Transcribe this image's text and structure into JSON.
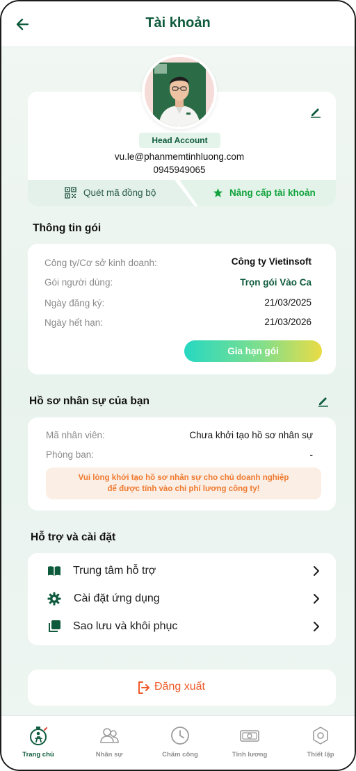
{
  "header": {
    "title": "Tài khoản"
  },
  "profile": {
    "role": "Head Account",
    "email": "vu.le@phanmemtinhluong.com",
    "phone": "0945949065",
    "scan_label": "Quét mã đồng bộ",
    "upgrade_label": "Nâng cấp tài khoản"
  },
  "package": {
    "title": "Thông tin gói",
    "rows": [
      {
        "label": "Công ty/Cơ sở kinh doanh:",
        "value": "Công ty Vietinsoft"
      },
      {
        "label": "Gói người dùng:",
        "value": "Trọn gói Vào Ca"
      },
      {
        "label": "Ngày đăng ký:",
        "value": "21/03/2025"
      },
      {
        "label": "Ngày hết hạn:",
        "value": "21/03/2026"
      }
    ],
    "renew_label": "Gia hạn gói"
  },
  "hr_profile": {
    "title": "Hồ sơ nhân sự của bạn",
    "rows": [
      {
        "label": "Mã nhân viên:",
        "value": "Chưa khởi tạo hồ sơ nhân sự"
      },
      {
        "label": "Phòng ban:",
        "value": "-"
      }
    ],
    "warning_line1": "Vui lòng khởi tạo hồ sơ nhân sự cho chủ doanh nghiệp",
    "warning_line2": "để được tính vào chi phí lương công ty!"
  },
  "support": {
    "title": "Hỗ trợ và cài đặt",
    "items": [
      {
        "label": "Trung tâm hỗ trợ",
        "icon": "book-icon"
      },
      {
        "label": "Cài đặt ứng dụng",
        "icon": "gear-icon"
      },
      {
        "label": "Sao lưu và khôi phục",
        "icon": "copy-icon"
      }
    ]
  },
  "logout": {
    "label": "Đăng xuất"
  },
  "nav": {
    "items": [
      {
        "label": "Trang chủ",
        "icon": "home-timer-icon",
        "active": true
      },
      {
        "label": "Nhân sự",
        "icon": "people-icon"
      },
      {
        "label": "Chấm công",
        "icon": "clock-icon"
      },
      {
        "label": "Tính lương",
        "icon": "money-icon"
      },
      {
        "label": "Thiết lập",
        "icon": "settings-icon"
      }
    ]
  },
  "colors": {
    "primary": "#0e5a3c",
    "accent_green": "#12a33c",
    "warning": "#ef7a2f",
    "logout": "#ef5a28"
  }
}
